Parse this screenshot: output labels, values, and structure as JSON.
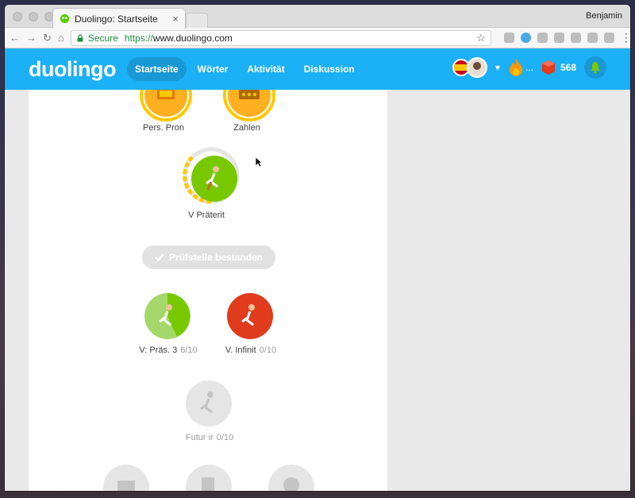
{
  "browser": {
    "tab_title": "Duolingo: Startseite",
    "tab_close": "×",
    "user_name": "Benjamin",
    "secure_label": "Secure",
    "url_protocol": "https://",
    "url_rest": "www.duolingo.com"
  },
  "header": {
    "logo": "duolingo",
    "nav": [
      "Startseite",
      "Wörter",
      "Aktivität",
      "Diskussion"
    ],
    "active_nav": "Startseite",
    "streak_text": "...",
    "gems": "568"
  },
  "skills": {
    "pers_pron": {
      "label": "Pers. Pron"
    },
    "zahlen": {
      "label": "Zahlen"
    },
    "v_praterit": {
      "label": "V Präterit"
    },
    "v_pras3": {
      "label": "V: Präs. 3",
      "progress": "6/10"
    },
    "v_infinit": {
      "label": "V. Infinit",
      "progress": "0/10"
    },
    "futur_ir": {
      "label": "Futur ir",
      "progress": "0/10"
    }
  },
  "checkpoint": {
    "label": "Prüfstelle bestanden"
  },
  "colors": {
    "duo_blue": "#1cb0f6",
    "gold": "#ffc800",
    "green": "#78c800",
    "red": "#e03b1c",
    "locked": "#e5e5e5"
  }
}
